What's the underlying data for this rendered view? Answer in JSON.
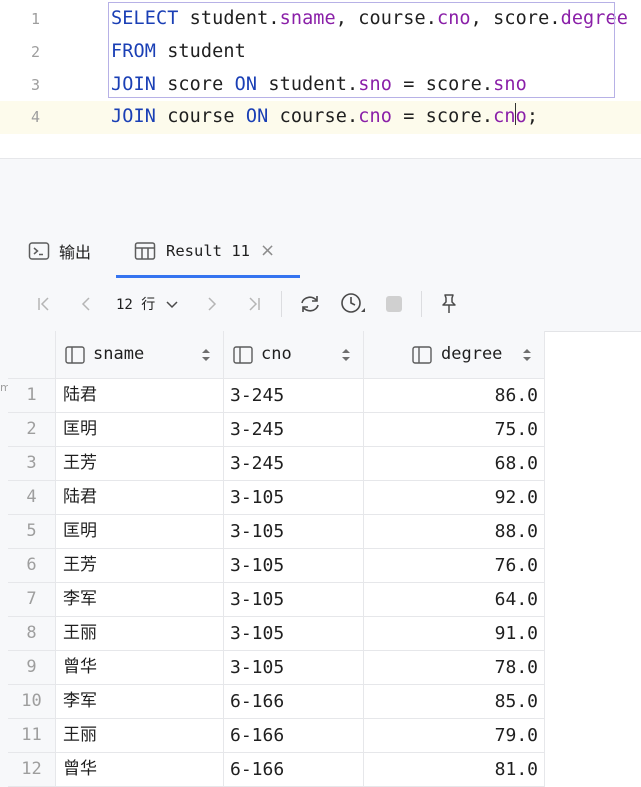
{
  "editor": {
    "lines": [
      {
        "num": "1",
        "tokens": [
          {
            "t": "SELECT",
            "c": "kw"
          },
          {
            "t": " student.",
            "c": ""
          },
          {
            "t": "sname",
            "c": "fld"
          },
          {
            "t": ", course.",
            "c": ""
          },
          {
            "t": "cno",
            "c": "fld"
          },
          {
            "t": ", score.",
            "c": ""
          },
          {
            "t": "degree",
            "c": "fld"
          }
        ]
      },
      {
        "num": "2",
        "tokens": [
          {
            "t": "FROM",
            "c": "kw"
          },
          {
            "t": " student",
            "c": ""
          }
        ]
      },
      {
        "num": "3",
        "tokens": [
          {
            "t": "JOIN",
            "c": "kw"
          },
          {
            "t": " score ",
            "c": ""
          },
          {
            "t": "ON",
            "c": "kw"
          },
          {
            "t": " student.",
            "c": ""
          },
          {
            "t": "sno",
            "c": "fld"
          },
          {
            "t": " = score.",
            "c": ""
          },
          {
            "t": "sno",
            "c": "fld"
          }
        ]
      },
      {
        "num": "4",
        "tokens": [
          {
            "t": "JOIN",
            "c": "kw"
          },
          {
            "t": " course ",
            "c": ""
          },
          {
            "t": "ON",
            "c": "kw"
          },
          {
            "t": " course.",
            "c": ""
          },
          {
            "t": "cno",
            "c": "fld"
          },
          {
            "t": " = score.",
            "c": ""
          },
          {
            "t": "cno",
            "c": "fld"
          },
          {
            "t": ";",
            "c": ""
          }
        ]
      }
    ]
  },
  "tabs": {
    "output_label": "输出",
    "result_label": "Result 11"
  },
  "toolbar": {
    "rows_count": "12 行"
  },
  "grid": {
    "columns": [
      "sname",
      "cno",
      "degree"
    ],
    "rows": [
      [
        "1",
        "陆君",
        "3-245",
        "86.0"
      ],
      [
        "2",
        "匡明",
        "3-245",
        "75.0"
      ],
      [
        "3",
        "王芳",
        "3-245",
        "68.0"
      ],
      [
        "4",
        "陆君",
        "3-105",
        "92.0"
      ],
      [
        "5",
        "匡明",
        "3-105",
        "88.0"
      ],
      [
        "6",
        "王芳",
        "3-105",
        "76.0"
      ],
      [
        "7",
        "李军",
        "3-105",
        "64.0"
      ],
      [
        "8",
        "王丽",
        "3-105",
        "91.0"
      ],
      [
        "9",
        "曾华",
        "3-105",
        "78.0"
      ],
      [
        "10",
        "李军",
        "6-166",
        "85.0"
      ],
      [
        "11",
        "王丽",
        "6-166",
        "79.0"
      ],
      [
        "12",
        "曾华",
        "6-166",
        "81.0"
      ]
    ]
  },
  "colors": {
    "keyword": "#1a3fb5",
    "field": "#8a1fa8",
    "accent": "#3574f0"
  }
}
